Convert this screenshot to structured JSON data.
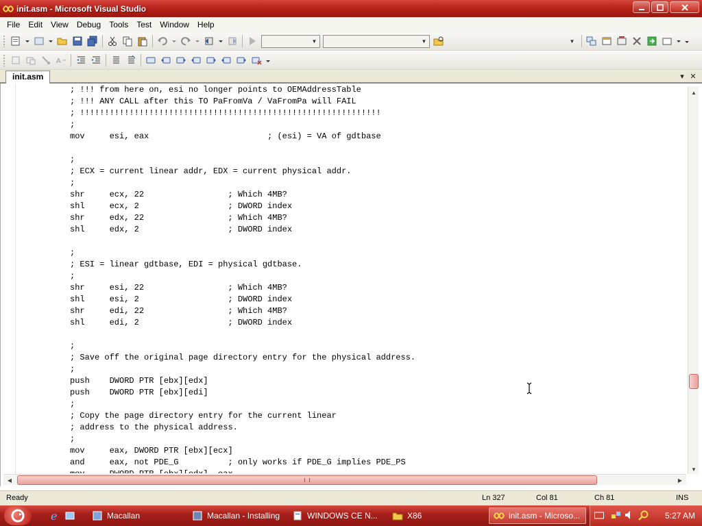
{
  "window": {
    "title": "init.asm - Microsoft Visual Studio"
  },
  "menu": [
    "File",
    "Edit",
    "View",
    "Debug",
    "Tools",
    "Test",
    "Window",
    "Help"
  ],
  "toolbar": {
    "combo_config": "",
    "combo_platform": "",
    "combo_find": ""
  },
  "tabs": {
    "active": "init.asm"
  },
  "editor": {
    "lines": [
      "; !!! from here on, esi no longer points to OEMAddressTable",
      "; !!! ANY CALL after this TO PaFromVa / VaFromPa will FAIL",
      "; !!!!!!!!!!!!!!!!!!!!!!!!!!!!!!!!!!!!!!!!!!!!!!!!!!!!!!!!!!!!!",
      ";",
      "mov     esi, eax                        ; (esi) = VA of gdtbase",
      "",
      ";",
      "; ECX = current linear addr, EDX = current physical addr.",
      ";",
      "shr     ecx, 22                 ; Which 4MB?",
      "shl     ecx, 2                  ; DWORD index",
      "shr     edx, 22                 ; Which 4MB?",
      "shl     edx, 2                  ; DWORD index",
      "",
      ";",
      "; ESI = linear gdtbase, EDI = physical gdtbase.",
      ";",
      "shr     esi, 22                 ; Which 4MB?",
      "shl     esi, 2                  ; DWORD index",
      "shr     edi, 22                 ; Which 4MB?",
      "shl     edi, 2                  ; DWORD index",
      "",
      ";",
      "; Save off the original page directory entry for the physical address.",
      ";",
      "push    DWORD PTR [ebx][edx]",
      "push    DWORD PTR [ebx][edi]",
      ";",
      "; Copy the page directory entry for the current linear",
      "; address to the physical address.",
      ";",
      "mov     eax, DWORD PTR [ebx][ecx]",
      "and     eax, not PDE_G          ; only works if PDE_G implies PDE_PS",
      "mov     DWORD PTR [ebx][edx], eax"
    ]
  },
  "status": {
    "state": "Ready",
    "ln": "Ln 327",
    "col": "Col 81",
    "ch": "Ch 81",
    "mode": "INS"
  },
  "taskbar": {
    "tasks": [
      {
        "label": "Macallan",
        "icon": "project-icon"
      },
      {
        "label": "Macallan - Installing",
        "icon": "installer-icon"
      },
      {
        "label": "WINDOWS CE N...",
        "icon": "document-icon"
      },
      {
        "label": "X86",
        "icon": "folder-icon"
      },
      {
        "label": "init.asm - Microso...",
        "icon": "visual-studio-icon"
      }
    ],
    "clock": "5:27 AM"
  },
  "colors": {
    "titlebar": "#b8231b",
    "taskbar": "#a8201a",
    "scroll_thumb": "#e9a19c"
  }
}
